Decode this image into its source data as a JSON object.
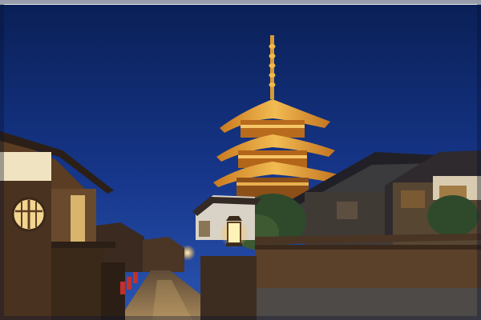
{
  "scene": {
    "colors": {
      "sky_top": "#0a1f55",
      "sky_mid": "#16368a",
      "sky_low": "#2b55b2",
      "pagoda_lit": "#e6a53a",
      "pagoda_glow": "#ffd27a",
      "wood_dark": "#2a1d12",
      "wood_mid": "#5a3d23",
      "stone_path": "#8f7350",
      "lantern_light": "#fff2b8"
    },
    "icons": {
      "emblem": "circle-window-icon",
      "pagoda": "pagoda-icon",
      "lantern": "street-lantern-icon"
    }
  }
}
